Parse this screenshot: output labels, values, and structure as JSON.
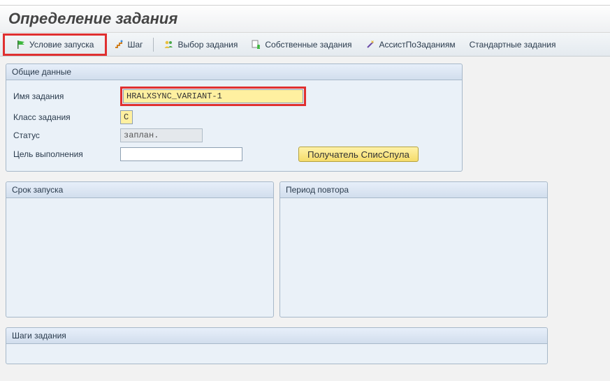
{
  "page": {
    "title": "Определение задания"
  },
  "toolbar": {
    "start_condition": "Условие запуска",
    "step": "Шаг",
    "select_task": "Выбор задания",
    "own_tasks": "Собственные задания",
    "task_assist": "АссистПоЗаданиям",
    "standard_tasks": "Стандартные задания"
  },
  "general": {
    "panel_title": "Общие данные",
    "fields": {
      "job_name": {
        "label": "Имя задания",
        "value": "HRALXSYNC_VARIANT-1"
      },
      "job_class": {
        "label": "Класс задания",
        "value": "C"
      },
      "status": {
        "label": "Статус",
        "value": "заплан."
      },
      "exec_target": {
        "label": "Цель выполнения",
        "value": ""
      }
    },
    "spool_recipient_btn": "Получатель СписСпула"
  },
  "start_panel": {
    "title": "Срок запуска"
  },
  "repeat_panel": {
    "title": "Период повтора"
  },
  "steps_panel": {
    "title": "Шаги задания"
  }
}
